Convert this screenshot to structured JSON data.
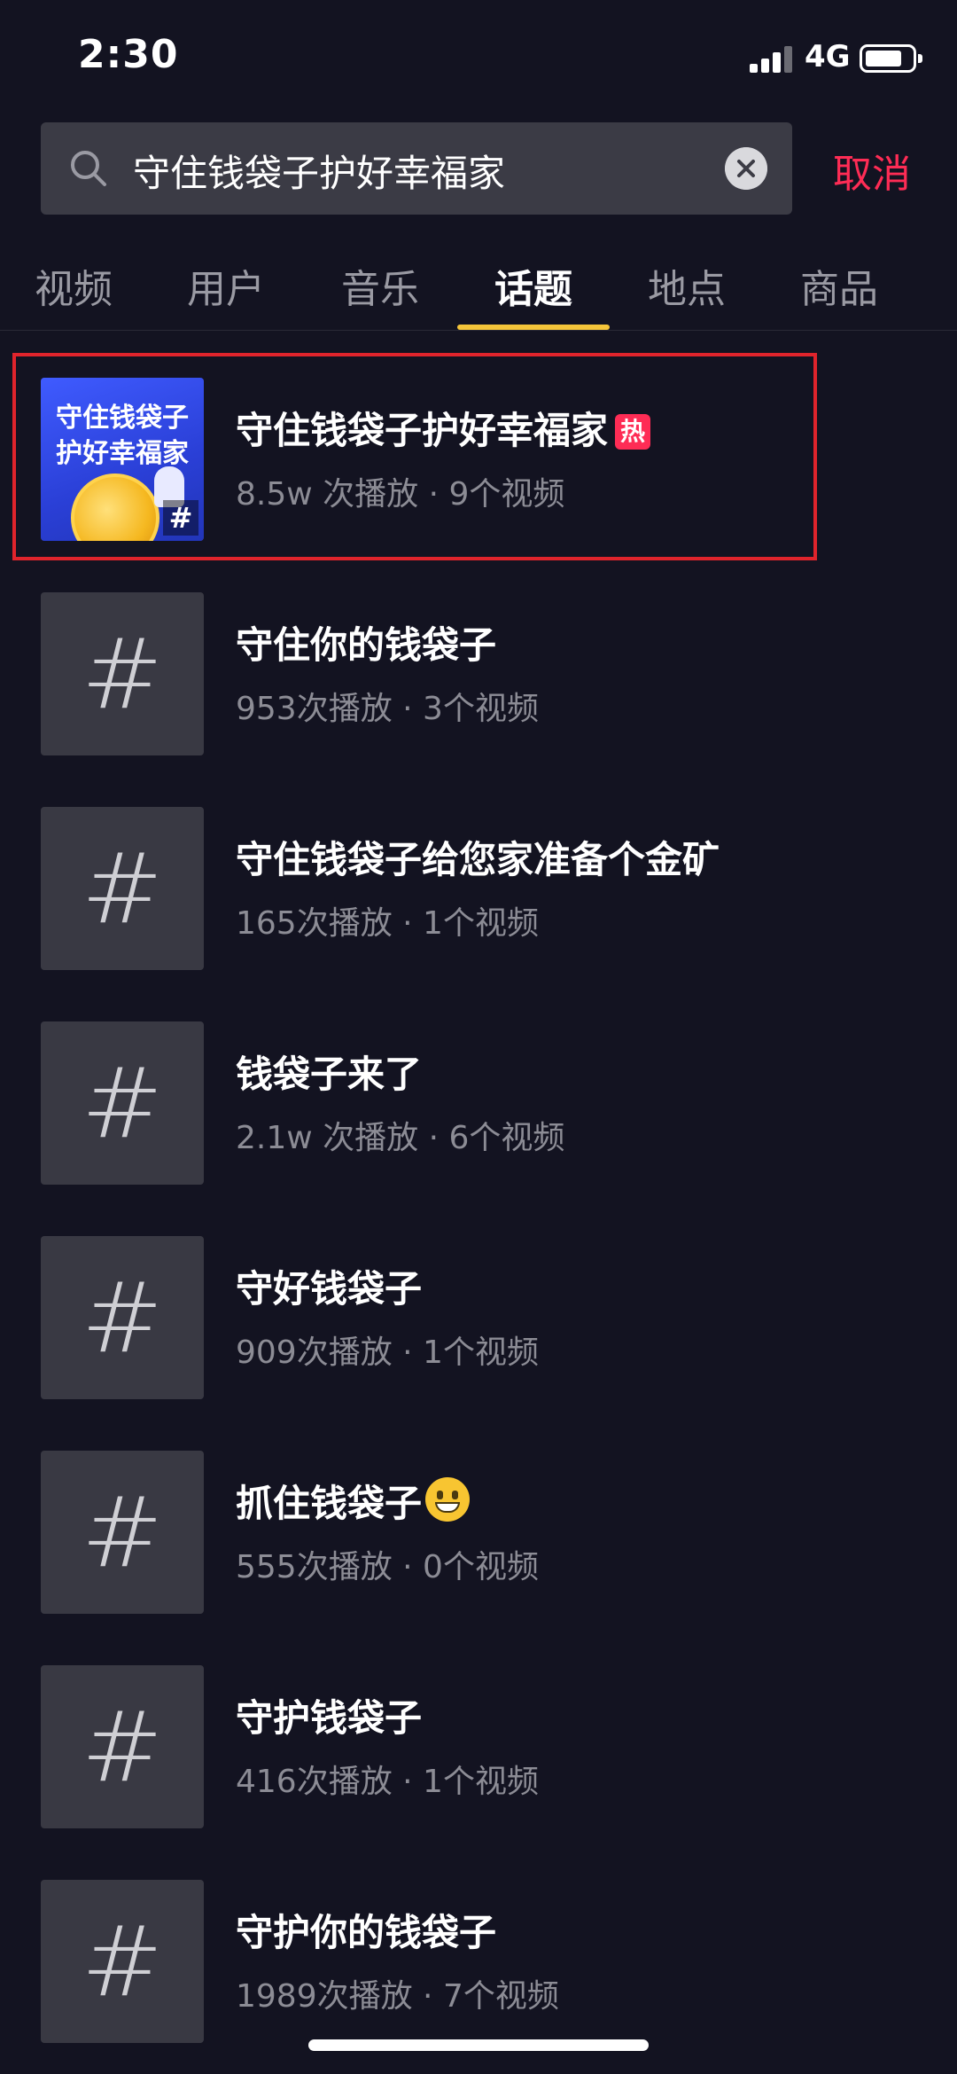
{
  "status_bar": {
    "time": "2:30",
    "network": "4G"
  },
  "search": {
    "query": "守住钱袋子护好幸福家",
    "cancel_label": "取消"
  },
  "tabs": [
    {
      "label": "视频"
    },
    {
      "label": "用户"
    },
    {
      "label": "音乐"
    },
    {
      "label": "话题",
      "active": true
    },
    {
      "label": "地点"
    },
    {
      "label": "商品"
    }
  ],
  "results": [
    {
      "title": "守住钱袋子护好幸福家",
      "badge": "热",
      "meta": "8.5w 次播放 · 9个视频",
      "thumb_lines": [
        "守住钱袋子",
        "护好幸福家"
      ],
      "highlighted": true
    },
    {
      "title": "守住你的钱袋子",
      "meta": "953次播放 · 3个视频",
      "icon": "hashtag-icon"
    },
    {
      "title": "守住钱袋子给您家准备个金矿",
      "meta": "165次播放 · 1个视频",
      "icon": "hashtag-icon"
    },
    {
      "title": "钱袋子来了",
      "meta": "2.1w 次播放 · 6个视频",
      "icon": "hashtag-icon"
    },
    {
      "title": "守好钱袋子",
      "meta": "909次播放 · 1个视频",
      "icon": "hashtag-icon"
    },
    {
      "title": "抓住钱袋子",
      "emoji": "grinning-face-emoji",
      "meta": "555次播放 · 0个视频",
      "icon": "hashtag-icon"
    },
    {
      "title": "守护钱袋子",
      "meta": "416次播放 · 1个视频",
      "icon": "hashtag-icon"
    },
    {
      "title": "守护你的钱袋子",
      "meta": "1989次播放 · 7个视频",
      "icon": "hashtag-icon"
    }
  ],
  "colors": {
    "accent": "#fe2c55",
    "tab_indicator": "#f5c53a",
    "highlight": "#e0242c",
    "background": "#131321"
  }
}
